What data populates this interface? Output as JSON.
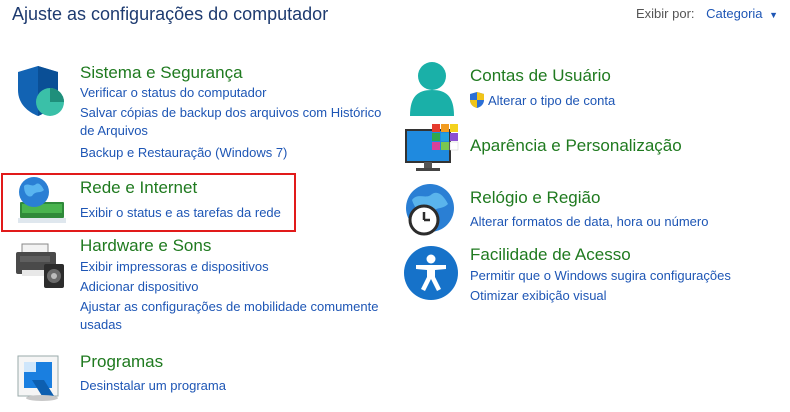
{
  "header": {
    "title": "Ajuste as configurações do computador",
    "view_by_label": "Exibir por:",
    "view_by_value": "Categoria"
  },
  "categories": {
    "system": {
      "title": "Sistema e Segurança",
      "links": [
        "Verificar o status do computador",
        "Salvar cópias de backup dos arquivos com Histórico",
        "de Arquivos",
        "Backup e Restauração (Windows 7)"
      ]
    },
    "network": {
      "title": "Rede e Internet",
      "links": [
        "Exibir o status e as tarefas da rede"
      ]
    },
    "hardware": {
      "title": "Hardware e Sons",
      "links": [
        "Exibir impressoras e dispositivos",
        "Adicionar dispositivo",
        "Ajustar as configurações de mobilidade comumente",
        "usadas"
      ]
    },
    "programs": {
      "title": "Programas",
      "links": [
        "Desinstalar um programa"
      ]
    },
    "users": {
      "title": "Contas de Usuário",
      "links": [
        "Alterar o tipo de conta"
      ]
    },
    "appearance": {
      "title": "Aparência e Personalização",
      "links": []
    },
    "clock": {
      "title": "Relógio e Região",
      "links": [
        "Alterar formatos de data, hora ou número"
      ]
    },
    "ease": {
      "title": "Facilidade de Acesso",
      "links": [
        "Permitir que o Windows sugira configurações",
        "Otimizar exibição visual"
      ]
    }
  },
  "colors": {
    "heading_green": "#1f7a1f",
    "link_blue": "#1e56b5",
    "title_navy": "#1e3b70",
    "highlight_red": "#e11a1a"
  }
}
